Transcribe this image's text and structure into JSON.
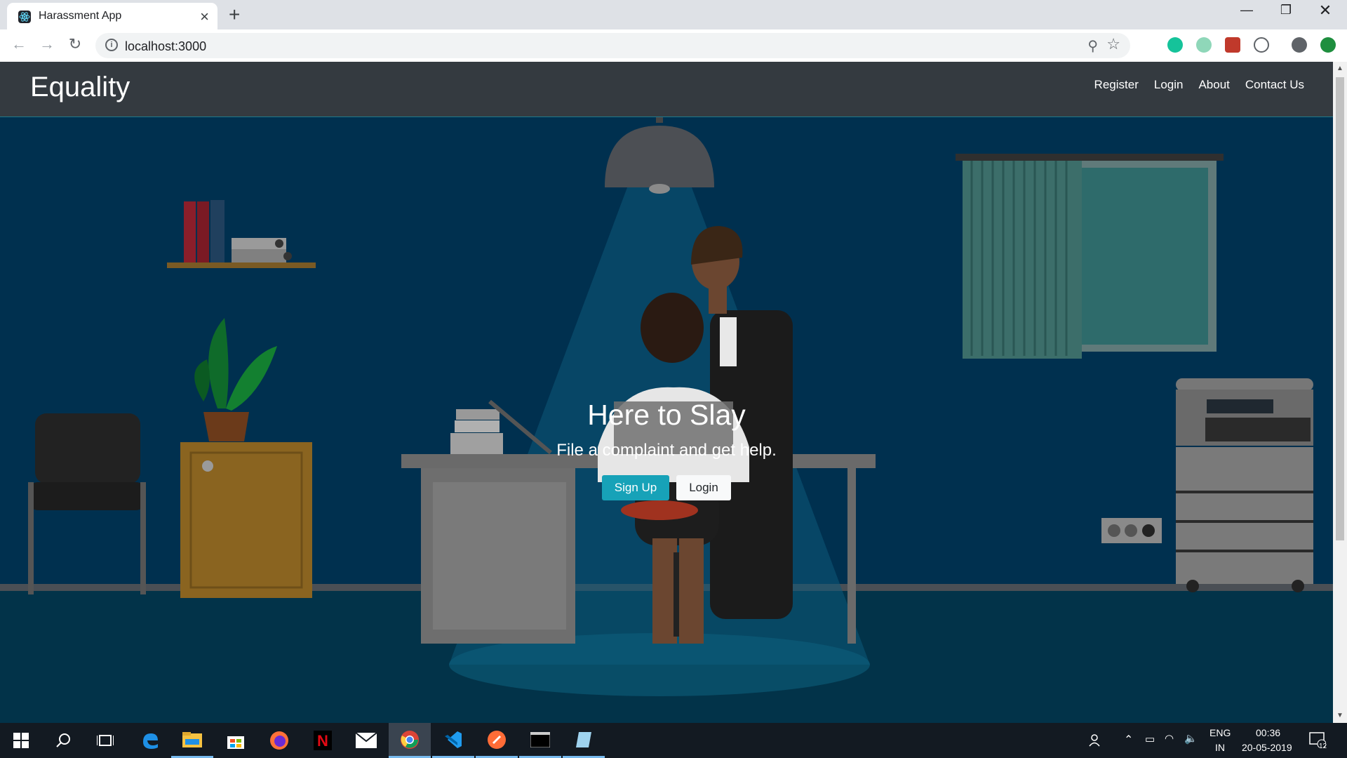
{
  "browser": {
    "tab_title": "Harassment App",
    "url": "localhost:3000"
  },
  "page": {
    "brand": "Equality",
    "nav": [
      "Register",
      "Login",
      "About",
      "Contact Us"
    ],
    "hero_title": "Here to Slay",
    "hero_subtitle": "File a complaint and get help.",
    "signup_label": "Sign Up",
    "login_label": "Login"
  },
  "taskbar": {
    "language_line1": "ENG",
    "language_line2": "IN",
    "time": "00:36",
    "date": "20-05-2019",
    "notification_count": "12"
  },
  "colors": {
    "navbar": "#343a40",
    "scene_bg": "#00304f",
    "primary_button": "#17a2b8"
  }
}
